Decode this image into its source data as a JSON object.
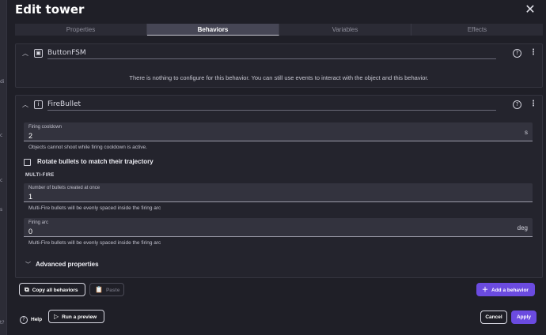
{
  "dialog": {
    "title": "Edit tower",
    "close_icon": "close-icon"
  },
  "tabs": [
    {
      "label": "Properties",
      "active": false
    },
    {
      "label": "Behaviors",
      "active": true
    },
    {
      "label": "Variables",
      "active": false
    },
    {
      "label": "Effects",
      "active": false
    }
  ],
  "behaviors": [
    {
      "name": "ButtonFSM",
      "icon": "button-icon",
      "message": "There is nothing to configure for this behavior. You can still use events to interact with the object and this behavior."
    },
    {
      "name": "FireBullet",
      "icon": "info-icon",
      "fields": {
        "cooldown": {
          "label": "Firing cooldown",
          "value": "2",
          "unit": "s",
          "helper": "Objects cannot shoot while firing cooldown is active."
        },
        "rotate": {
          "label": "Rotate bullets to match their trajectory",
          "checked": false
        },
        "section": "MULTI-FIRE",
        "count": {
          "label": "Number of bullets created at once",
          "value": "1",
          "helper": "Multi-Fire bullets will be evenly spaced inside the firing arc"
        },
        "arc": {
          "label": "Firing arc",
          "value": "0",
          "unit": "deg",
          "helper": "Multi-Fire bullets will be evenly spaced inside the firing arc"
        }
      },
      "advanced_label": "Advanced properties"
    }
  ],
  "actions": {
    "copy_all": "Copy all behaviors",
    "paste": "Paste",
    "add_behavior": "Add a behavior",
    "help": "Help",
    "run_preview": "Run a preview",
    "cancel": "Cancel",
    "apply": "Apply"
  },
  "colors": {
    "accent": "#6b4be0",
    "background": "#1f1f27"
  }
}
